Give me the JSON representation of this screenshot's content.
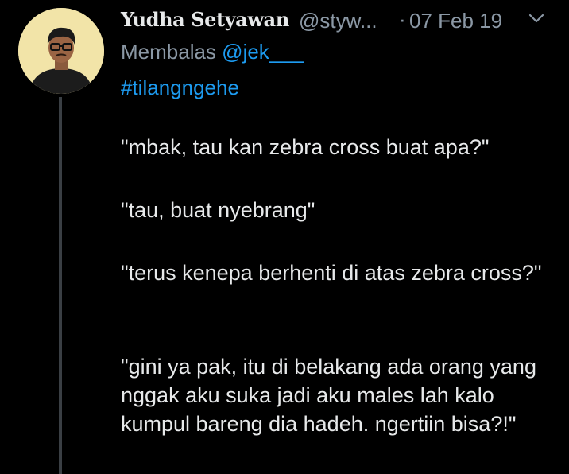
{
  "tweet": {
    "display_name": "Yudha Setyawan",
    "handle": "@styw...",
    "separator": "·",
    "date": "07 Feb 19",
    "reply_prefix": "Membalas",
    "reply_mention": "@jek___",
    "hashtag": "#tilangngehe",
    "paragraphs": [
      "\"mbak, tau kan zebra cross buat apa?\"",
      "\"tau, buat nyebrang\"",
      "\"terus kenepa berhenti di atas zebra cross?\"",
      "\"gini ya pak, itu di belakang ada orang yang nggak aku suka jadi aku males lah kalo kumpul bareng dia hadeh. ngertiin bisa?!\""
    ]
  },
  "icons": {
    "caret": "chevron-down-icon",
    "avatar": "profile-avatar"
  },
  "colors": {
    "background": "#000000",
    "text": "#e7e9ea",
    "muted": "#8b98a5",
    "link": "#1d9bf0",
    "thread_line": "#3a3f44"
  }
}
